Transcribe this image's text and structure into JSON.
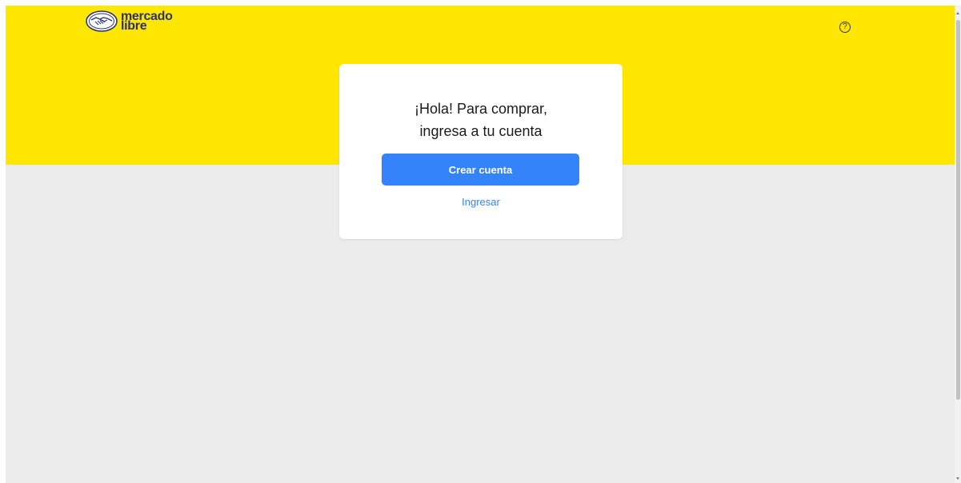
{
  "header": {
    "logo": {
      "line1": "mercado",
      "line2": "libre",
      "icon": "handshake-logo-icon"
    },
    "help_icon": {
      "icon": "help-circle-icon",
      "glyph": "?"
    }
  },
  "card": {
    "title_line1": "¡Hola! Para comprar,",
    "title_line2": "ingresa a tu cuenta",
    "primary_button_label": "Crear cuenta",
    "secondary_link_label": "Ingresar"
  },
  "colors": {
    "header_yellow": "#ffe600",
    "background_gray": "#ebebeb",
    "primary_blue": "#3483fa",
    "logo_navy": "#2d3277"
  }
}
